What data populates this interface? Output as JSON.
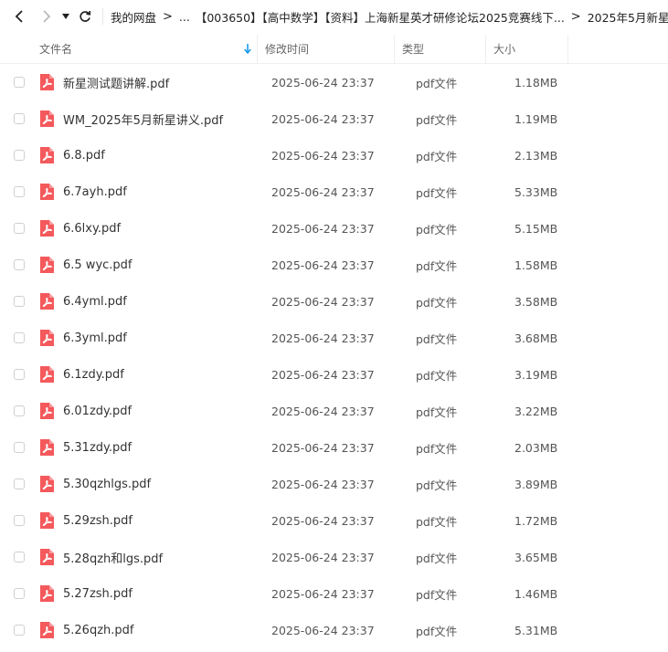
{
  "nav": {
    "back_icon": "chevron-left-icon",
    "forward_icon": "chevron-right-icon",
    "history_icon": "caret-down-icon",
    "refresh_icon": "refresh-icon"
  },
  "breadcrumb": {
    "items": [
      "我的网盘",
      "...",
      "【003650】【高中数学】【资料】上海新星英才研修论坛2025竞赛线下...",
      "2025年5月新星"
    ],
    "separator": ">"
  },
  "columns": {
    "name": "文件名",
    "modified": "修改时间",
    "type": "类型",
    "size": "大小",
    "sort_icon": "sort-arrow-down-icon",
    "sort_color": "#1a9bf0"
  },
  "colors": {
    "pdf_icon": "#f4595c",
    "text": "#333333"
  },
  "files": [
    {
      "name": "新星测试题讲解.pdf",
      "modified": "2025-06-24 23:37",
      "type": "pdf文件",
      "size": "1.18MB"
    },
    {
      "name": "WM_2025年5月新星讲义.pdf",
      "modified": "2025-06-24 23:37",
      "type": "pdf文件",
      "size": "1.19MB"
    },
    {
      "name": "6.8.pdf",
      "modified": "2025-06-24 23:37",
      "type": "pdf文件",
      "size": "2.13MB"
    },
    {
      "name": "6.7ayh.pdf",
      "modified": "2025-06-24 23:37",
      "type": "pdf文件",
      "size": "5.33MB"
    },
    {
      "name": "6.6lxy.pdf",
      "modified": "2025-06-24 23:37",
      "type": "pdf文件",
      "size": "5.15MB"
    },
    {
      "name": "6.5 wyc.pdf",
      "modified": "2025-06-24 23:37",
      "type": "pdf文件",
      "size": "1.58MB"
    },
    {
      "name": "6.4yml.pdf",
      "modified": "2025-06-24 23:37",
      "type": "pdf文件",
      "size": "3.58MB"
    },
    {
      "name": "6.3yml.pdf",
      "modified": "2025-06-24 23:37",
      "type": "pdf文件",
      "size": "3.68MB"
    },
    {
      "name": "6.1zdy.pdf",
      "modified": "2025-06-24 23:37",
      "type": "pdf文件",
      "size": "3.19MB"
    },
    {
      "name": "6.01zdy.pdf",
      "modified": "2025-06-24 23:37",
      "type": "pdf文件",
      "size": "3.22MB"
    },
    {
      "name": "5.31zdy.pdf",
      "modified": "2025-06-24 23:37",
      "type": "pdf文件",
      "size": "2.03MB"
    },
    {
      "name": "5.30qzhlgs.pdf",
      "modified": "2025-06-24 23:37",
      "type": "pdf文件",
      "size": "3.89MB"
    },
    {
      "name": "5.29zsh.pdf",
      "modified": "2025-06-24 23:37",
      "type": "pdf文件",
      "size": "1.72MB"
    },
    {
      "name": "5.28qzh和lgs.pdf",
      "modified": "2025-06-24 23:37",
      "type": "pdf文件",
      "size": "3.65MB"
    },
    {
      "name": "5.27zsh.pdf",
      "modified": "2025-06-24 23:37",
      "type": "pdf文件",
      "size": "1.46MB"
    },
    {
      "name": "5.26qzh.pdf",
      "modified": "2025-06-24 23:37",
      "type": "pdf文件",
      "size": "5.31MB"
    }
  ]
}
